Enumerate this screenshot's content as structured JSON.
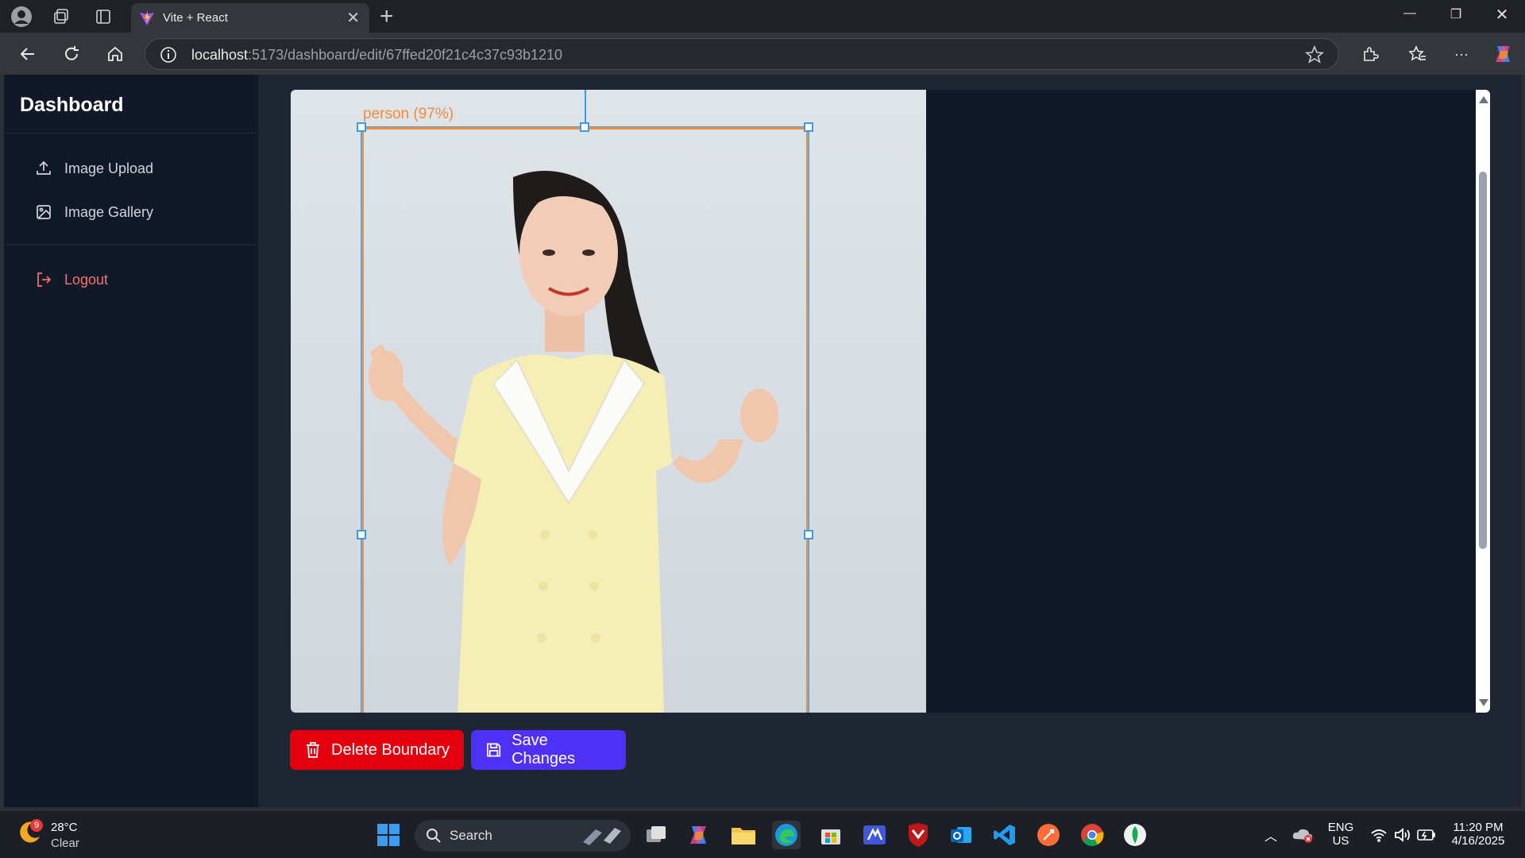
{
  "browser": {
    "tab_title": "Vite + React",
    "url_host": "localhost",
    "url_path": ":5173/dashboard/edit/67ffed20f21c4c37c93b1210"
  },
  "sidebar": {
    "brand": "Dashboard",
    "items": [
      {
        "label": "Image Upload",
        "icon": "upload-icon"
      },
      {
        "label": "Image Gallery",
        "icon": "image-icon"
      }
    ],
    "logout_label": "Logout"
  },
  "editor": {
    "detection_label": "person (97%)",
    "delete_label": "Delete Boundary",
    "save_label": "Save Changes"
  },
  "taskbar": {
    "weather_temp": "28°C",
    "weather_cond": "Clear",
    "weather_badge": "9",
    "search_label": "Search",
    "lang_1": "ENG",
    "lang_2": "US",
    "time": "11:20 PM",
    "date": "4/16/2025"
  },
  "colors": {
    "bbox": "#f28b3c",
    "handle": "#3b9ae1",
    "delete_button": "#e5000f",
    "save_button": "#4f30f5",
    "logout": "#f87171"
  }
}
